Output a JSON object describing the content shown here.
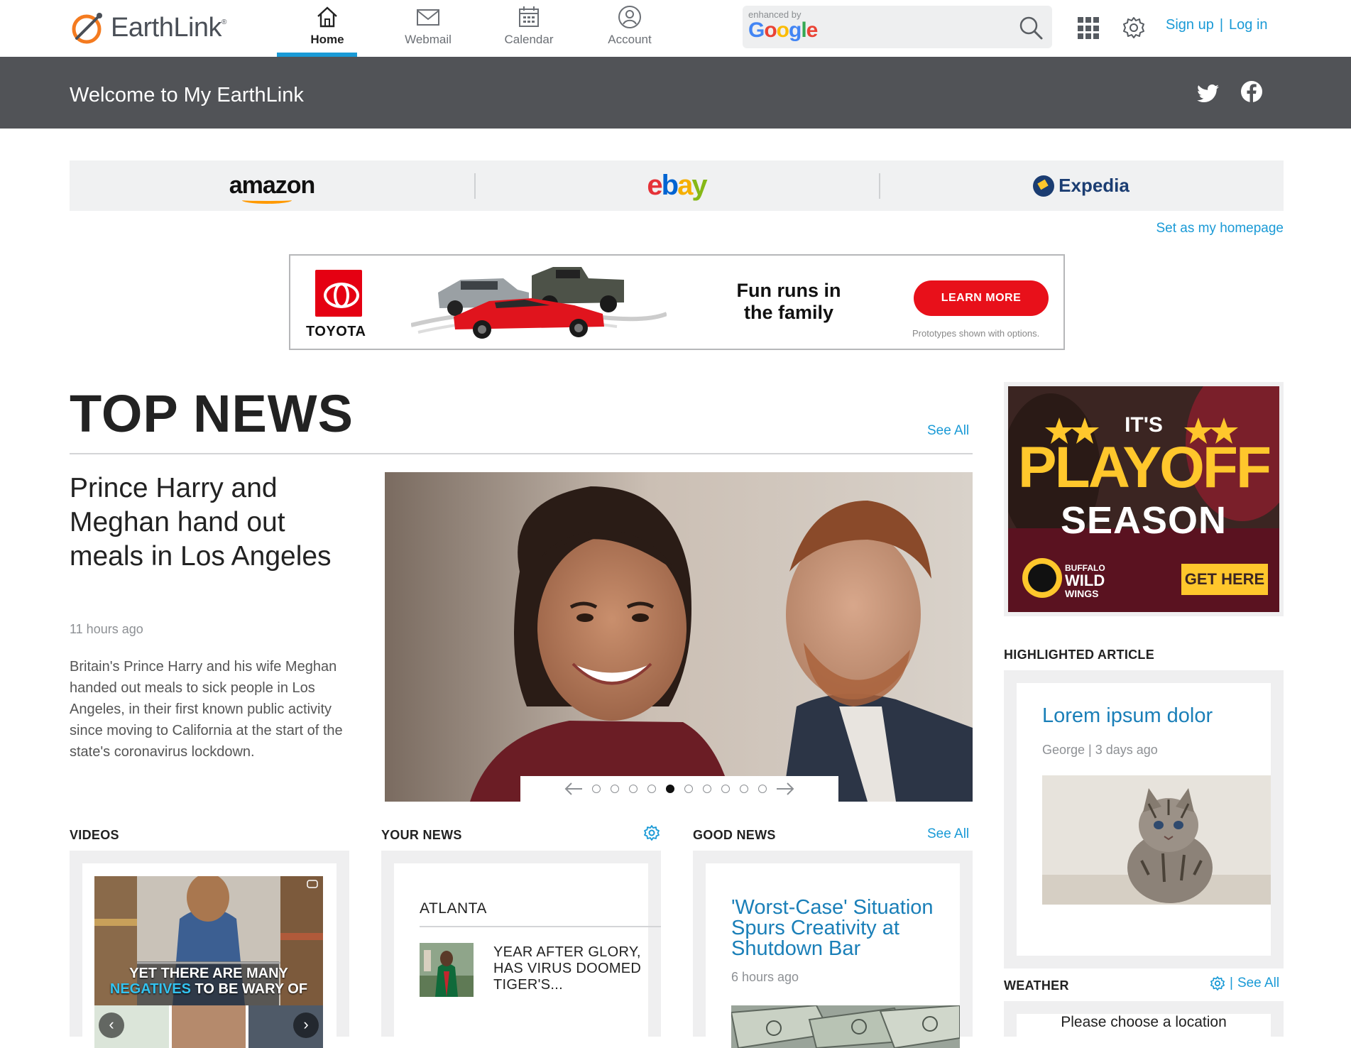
{
  "brand": {
    "name": "EarthLink",
    "trademark": "®"
  },
  "nav": [
    {
      "label": "Home",
      "icon": "home-icon",
      "active": true
    },
    {
      "label": "Webmail",
      "icon": "mail-icon",
      "active": false
    },
    {
      "label": "Calendar",
      "icon": "calendar-icon",
      "active": false
    },
    {
      "label": "Account",
      "icon": "account-icon",
      "active": false
    }
  ],
  "search": {
    "badge_small": "enhanced by",
    "badge_brand": "Google",
    "value": ""
  },
  "auth": {
    "signup": "Sign up",
    "separator": "|",
    "login": "Log in"
  },
  "welcome": {
    "title": "Welcome to My EarthLink"
  },
  "partners": {
    "amazon": "amazon",
    "ebay": "ebay",
    "expedia": "Expedia"
  },
  "set_homepage": "Set as my homepage",
  "ad_toyota": {
    "brand": "TOYOTA",
    "headline_1": "Fun runs in",
    "headline_2": "the family",
    "button": "LEARN MORE",
    "note": "Prototypes shown with options."
  },
  "top_news": {
    "title": "TOP NEWS",
    "see_all": "See All",
    "headline": "Prince Harry and Meghan hand out meals in Los Angeles",
    "time": "11 hours ago",
    "summary": "Britain's Prince Harry and his wife Meghan handed out meals to sick people in Los Angeles, in their first known public activity since moving to California at the start of the state's coronavirus lockdown.",
    "carousel_count": 10,
    "carousel_active": 5
  },
  "ad_bww": {
    "line1": "IT'S",
    "line2": "PLAYOFF",
    "line3": "SEASON",
    "brand_1": "BUFFALO",
    "brand_2": "WILD",
    "brand_3": "WINGS",
    "button": "GET HERE"
  },
  "videos": {
    "heading": "VIDEOS",
    "caption_1": "YET THERE ARE MANY",
    "caption_accent": "NEGATIVES",
    "caption_2": "TO BE WARY OF"
  },
  "your_news": {
    "heading": "YOUR NEWS",
    "city": "ATLANTA",
    "item_title": "YEAR AFTER GLORY, HAS VIRUS DOOMED TIGER'S..."
  },
  "good_news": {
    "heading": "GOOD NEWS",
    "see_all": "See All",
    "title": "'Worst-Case' Situation Spurs Creativity at Shutdown Bar",
    "time": "6 hours ago"
  },
  "highlighted": {
    "heading": "HIGHLIGHTED ARTICLE",
    "title": "Lorem ipsum dolor",
    "meta": "George | 3 days ago"
  },
  "weather": {
    "heading": "WEATHER",
    "separator": "|",
    "see_all": "See All",
    "prompt": "Please choose a location"
  },
  "colors": {
    "accent": "#1a9ad6",
    "banner": "#515357",
    "link_dark": "#1a7fb8",
    "toyota_red": "#e8101a",
    "bww_yellow": "#ffc72c"
  }
}
